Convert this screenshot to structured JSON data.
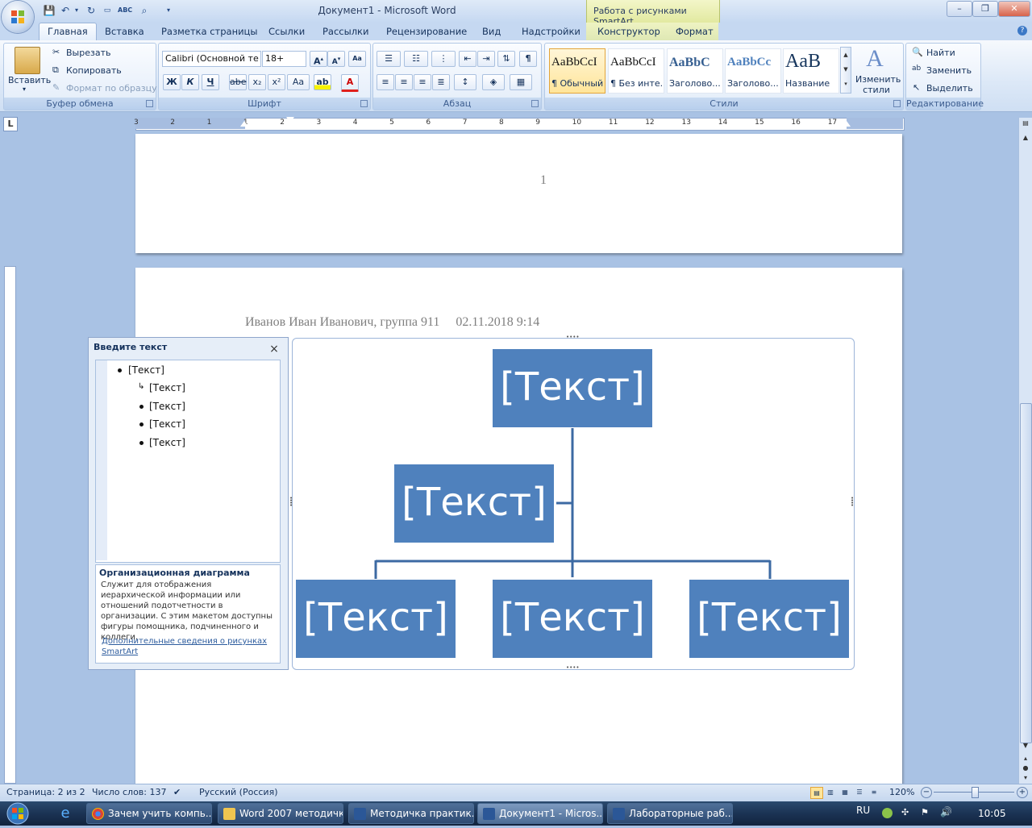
{
  "window": {
    "title": "Документ1 - Microsoft Word",
    "context_tab": "Работа с рисунками SmartArt"
  },
  "tabs": [
    "Главная",
    "Вставка",
    "Разметка страницы",
    "Ссылки",
    "Рассылки",
    "Рецензирование",
    "Вид",
    "Надстройки",
    "Конструктор",
    "Формат"
  ],
  "ribbon": {
    "clipboard": {
      "paste": "Вставить",
      "cut": "Вырезать",
      "copy": "Копировать",
      "format_painter": "Формат по образцу",
      "caption": "Буфер обмена"
    },
    "font": {
      "name": "Calibri (Основной те",
      "size": "18+",
      "bold": "Ж",
      "italic": "К",
      "underline": "Ч",
      "strike": "abe",
      "sub": "x₂",
      "sup": "x²",
      "case": "Aa",
      "caption": "Шрифт"
    },
    "paragraph": {
      "caption": "Абзац"
    },
    "styles": {
      "items": [
        {
          "preview": "AaBbCcI",
          "name": "¶ Обычный"
        },
        {
          "preview": "AaBbCcI",
          "name": "¶ Без инте..."
        },
        {
          "preview": "AaBbC",
          "name": "Заголово..."
        },
        {
          "preview": "AaBbCc",
          "name": "Заголово..."
        },
        {
          "preview": "AaB",
          "name": "Название"
        }
      ],
      "change": "Изменить стили",
      "caption": "Стили"
    },
    "editing": {
      "find": "Найти",
      "replace": "Заменить",
      "select": "Выделить",
      "caption": "Редактирование"
    }
  },
  "ruler": {
    "tab_selector": "L",
    "numbers": [
      "3",
      "2",
      "1",
      "1",
      "2",
      "3",
      "4",
      "5",
      "6",
      "7",
      "8",
      "9",
      "10",
      "11",
      "12",
      "13",
      "14",
      "15",
      "16",
      "17"
    ]
  },
  "document": {
    "page_number": "1",
    "header": "Иванов Иван Иванович, группа 911     02.11.2018 9:14"
  },
  "text_pane": {
    "title": "Введите текст",
    "close": "×",
    "items": [
      "[Текст]",
      "[Текст]",
      "[Текст]",
      "[Текст]",
      "[Текст]"
    ],
    "desc_title": "Организационная диаграмма",
    "desc_text": "Служит для отображения иерархической информации или отношений подотчетности в организации. С этим макетом доступны фигуры помощника, подчиненного и коллеги.",
    "link": "Дополнительные сведения о рисунках SmartArt"
  },
  "smartart": {
    "top": "[Текст]",
    "assistant": "[Текст]",
    "children": [
      "[Текст]",
      "[Текст]",
      "[Текст]"
    ],
    "color": "#4f81bd"
  },
  "status": {
    "page": "Страница: 2 из 2",
    "words": "Число слов: 137",
    "language": "Русский (Россия)",
    "zoom": "120%"
  },
  "taskbar": {
    "items": [
      "Зачем учить компь...",
      "Word 2007 методичка",
      "Методичка практик...",
      "Документ1 - Micros...",
      "Лабораторные раб..."
    ],
    "lang": "RU",
    "clock": "10:05"
  }
}
